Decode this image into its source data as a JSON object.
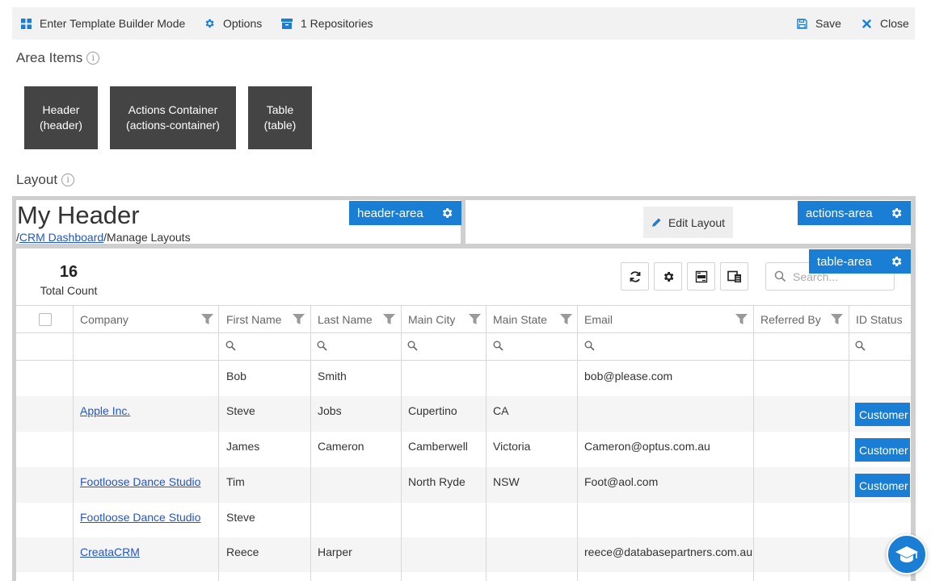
{
  "toolbar": {
    "template_builder": "Enter Template Builder Mode",
    "options": "Options",
    "repositories": "1 Repositories",
    "save": "Save",
    "close": "Close"
  },
  "area_items": {
    "title": "Area Items",
    "info": "i",
    "tiles": [
      {
        "name": "Header",
        "id": "(header)"
      },
      {
        "name": "Actions Container",
        "id": "(actions-container)"
      },
      {
        "name": "Table",
        "id": "(table)"
      }
    ]
  },
  "layout": {
    "title": "Layout",
    "info": "i",
    "header": {
      "title": "My Header",
      "crumb_sep": "/",
      "crumb_link": "CRM Dashboard",
      "crumb_tail": "/Manage Layouts"
    },
    "tags": {
      "header_area": "header-area",
      "actions_area": "actions-area",
      "table_area": "table-area"
    },
    "edit_layout": "Edit Layout"
  },
  "table": {
    "count": "16",
    "count_label": "Total Count",
    "search_placeholder": "Search...",
    "columns": [
      "Company",
      "First Name",
      "Last Name",
      "Main City",
      "Main State",
      "Email",
      "Referred By",
      "ID Status"
    ],
    "rows": [
      {
        "company": "",
        "first": "Bob",
        "last": "Smith",
        "city": "",
        "state": "",
        "email": "bob@please.com",
        "referred": "",
        "status": ""
      },
      {
        "company": "Apple Inc.",
        "first": "Steve",
        "last": "Jobs",
        "city": "Cupertino",
        "state": "CA",
        "email": "",
        "referred": "",
        "status": "Customer"
      },
      {
        "company": "",
        "first": "James",
        "last": "Cameron",
        "city": "Camberwell",
        "state": "Victoria",
        "email": "Cameron@optus.com.au",
        "referred": "",
        "status": "Customer"
      },
      {
        "company": "Footloose Dance Studio",
        "first": "Tim",
        "last": "",
        "city": "North Ryde",
        "state": "NSW",
        "email": "Foot@aol.com",
        "referred": "",
        "status": "Customer"
      },
      {
        "company": "Footloose Dance Studio",
        "first": "Steve",
        "last": "",
        "city": "",
        "state": "",
        "email": "",
        "referred": "",
        "status": ""
      },
      {
        "company": "CreataCRM",
        "first": "Reece",
        "last": "Harper",
        "city": "",
        "state": "",
        "email": "reece@databasepartners.com.au",
        "referred": "",
        "status": ""
      }
    ]
  },
  "colors": {
    "accent": "#1a7fd4",
    "tile": "#444444",
    "frame": "#cfcfcf",
    "link": "#2255cc"
  },
  "icons": {
    "toolbar": [
      "grid-icon",
      "gear-icon",
      "archive-icon",
      "floppy-save-icon",
      "close-x-icon"
    ],
    "table_tools": [
      "refresh-icon",
      "gear-icon",
      "xlsx-export-icon",
      "column-chooser-icon"
    ]
  }
}
